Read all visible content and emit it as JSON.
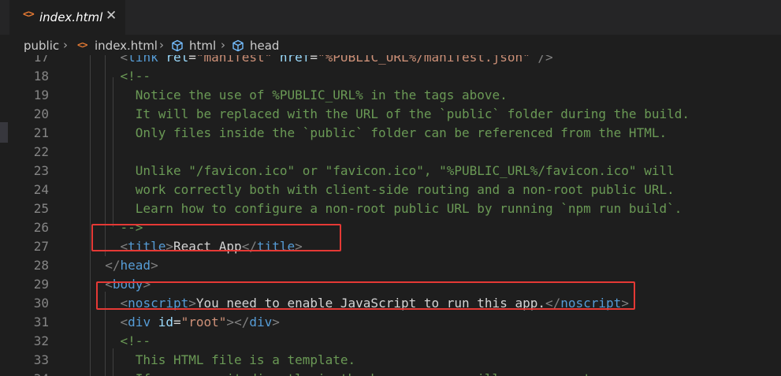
{
  "tab": {
    "icon": "html-file-icon",
    "label": "index.html",
    "close_symbol": "✕"
  },
  "breadcrumb": {
    "items": [
      "public",
      "index.html",
      "html",
      "head"
    ]
  },
  "colors": {
    "highlight_box": "#e53935",
    "comment": "#6a9955",
    "tag": "#569cd6",
    "attribute": "#9cdcfe",
    "string": "#ce9178",
    "text": "#d4d4d4"
  },
  "lines": [
    {
      "n": "17",
      "code": "    <link rel=\"manifest\" href=\"%PUBLIC_URL%/manifest.json\" />"
    },
    {
      "n": "18",
      "code": "    <!--"
    },
    {
      "n": "19",
      "code": "      Notice the use of %PUBLIC_URL% in the tags above."
    },
    {
      "n": "20",
      "code": "      It will be replaced with the URL of the `public` folder during the build."
    },
    {
      "n": "21",
      "code": "      Only files inside the `public` folder can be referenced from the HTML."
    },
    {
      "n": "22",
      "code": ""
    },
    {
      "n": "23",
      "code": "      Unlike \"/favicon.ico\" or \"favicon.ico\", \"%PUBLIC_URL%/favicon.ico\" will"
    },
    {
      "n": "24",
      "code": "      work correctly both with client-side routing and a non-root public URL."
    },
    {
      "n": "25",
      "code": "      Learn how to configure a non-root public URL by running `npm run build`."
    },
    {
      "n": "26",
      "code": "    -->"
    },
    {
      "n": "27",
      "code": "    <title>React App</title>"
    },
    {
      "n": "28",
      "code": "  </head>"
    },
    {
      "n": "29",
      "code": "  <body>"
    },
    {
      "n": "30",
      "code": "    <noscript>You need to enable JavaScript to run this app.</noscript>"
    },
    {
      "n": "31",
      "code": "    <div id=\"root\"></div>"
    },
    {
      "n": "32",
      "code": "    <!--"
    },
    {
      "n": "33",
      "code": "      This HTML file is a template."
    },
    {
      "n": "34",
      "code": "      If you open it directly in the browser, you will see an empty page."
    }
  ]
}
